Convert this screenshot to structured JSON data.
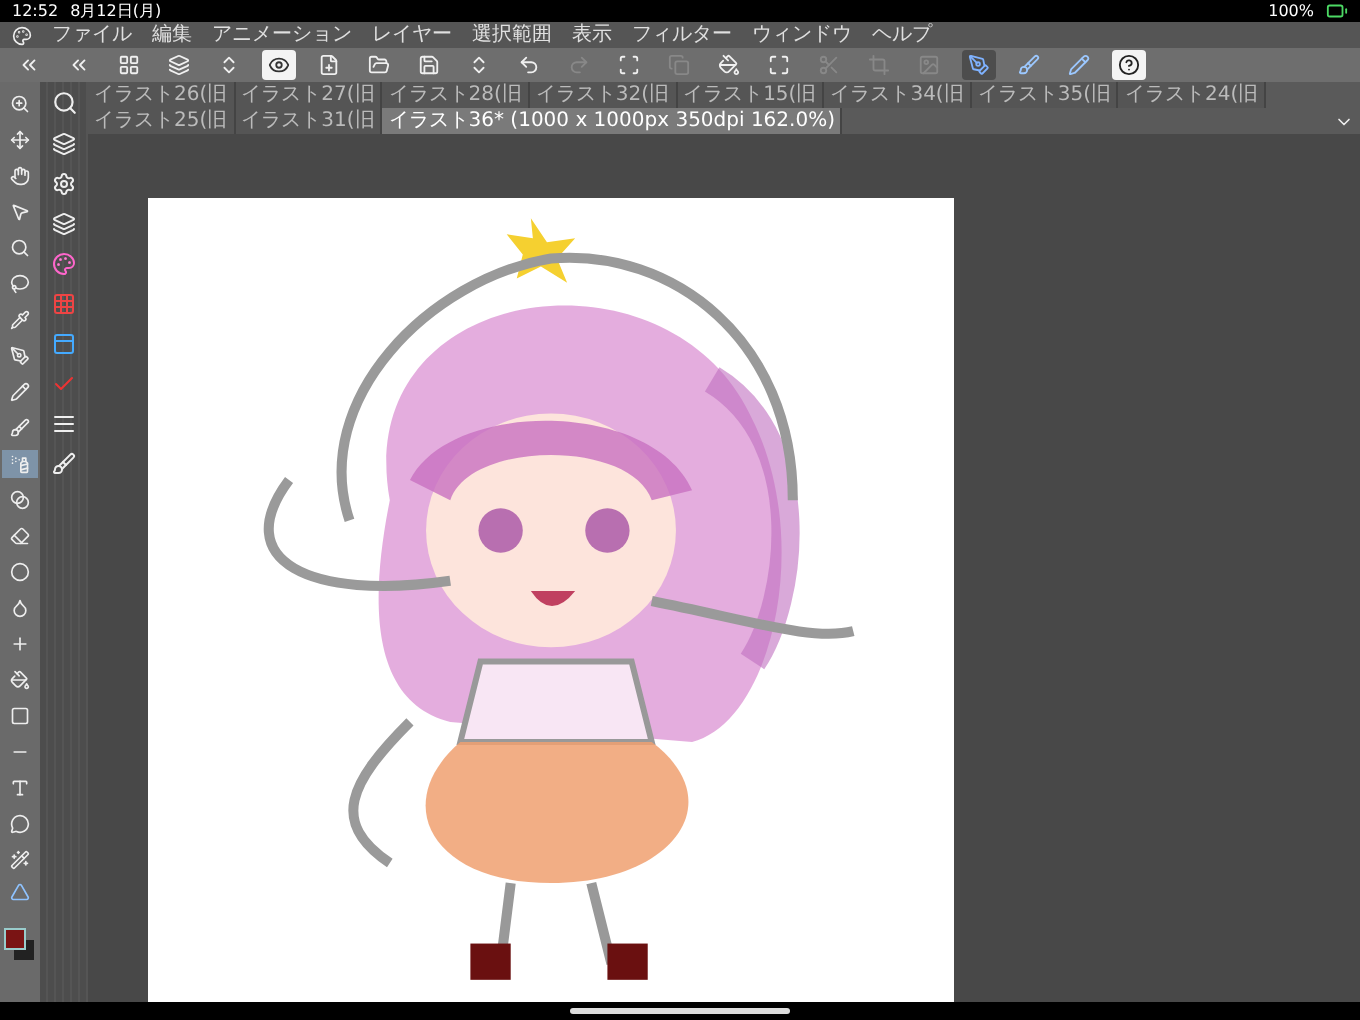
{
  "status_bar": {
    "time": "12:52",
    "date": "8月12日(月)",
    "battery": "100%"
  },
  "menu": [
    "ファイル",
    "編集",
    "アニメーション",
    "レイヤー",
    "選択範囲",
    "表示",
    "フィルター",
    "ウィンドウ",
    "ヘルプ"
  ],
  "pressure_toggles": [
    {
      "on": true
    },
    {
      "on": false
    },
    {
      "on": false
    }
  ],
  "document_tabs": [
    {
      "label": "イラスト26(旧",
      "selected": false
    },
    {
      "label": "イラスト27(旧",
      "selected": false
    },
    {
      "label": "イラスト28(旧",
      "selected": false
    },
    {
      "label": "イラスト32(旧",
      "selected": false
    },
    {
      "label": "イラスト15(旧",
      "selected": false
    },
    {
      "label": "イラスト34(旧",
      "selected": false
    },
    {
      "label": "イラスト35(旧",
      "selected": false
    },
    {
      "label": "イラスト24(旧",
      "selected": false
    },
    {
      "label": "イラスト25(旧",
      "selected": false
    },
    {
      "label": "イラスト31(旧",
      "selected": false
    },
    {
      "label": "イラスト36* (1000 x 1000px 350dpi 162.0%)",
      "selected": true
    }
  ],
  "tools": [
    {
      "selected": false
    },
    {
      "selected": false
    },
    {
      "selected": false
    },
    {
      "selected": false
    },
    {
      "selected": false
    },
    {
      "selected": false
    },
    {
      "selected": false
    },
    {
      "selected": false
    },
    {
      "selected": false
    },
    {
      "selected": false
    },
    {
      "selected": true
    },
    {
      "selected": false
    },
    {
      "selected": false
    },
    {
      "selected": false
    },
    {
      "selected": false
    },
    {
      "selected": false
    },
    {
      "selected": false
    },
    {
      "selected": false
    },
    {
      "selected": false
    },
    {
      "selected": false
    },
    {
      "selected": false
    },
    {
      "selected": false
    }
  ]
}
